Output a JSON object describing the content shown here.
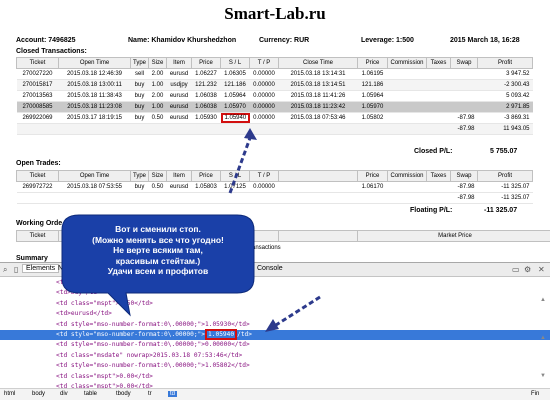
{
  "site": {
    "title": "Smart-Lab.ru"
  },
  "account": {
    "number": "Account: 7496825",
    "name": "Name: Khamidov Khurshedzhon",
    "currency": "Currency: RUR",
    "leverage": "Leverage: 1:500",
    "datetime": "2015 March 18, 16:28"
  },
  "closed": {
    "heading": "Closed Transactions:",
    "headers": [
      "Ticket",
      "Open Time",
      "Type",
      "Size",
      "Item",
      "Price",
      "S / L",
      "T / P",
      "Close Time",
      "Price",
      "Commission",
      "Taxes",
      "Swap",
      "Profit"
    ],
    "rows": [
      [
        "270027220",
        "2015.03.18 12:46:39",
        "sell",
        "2.00",
        "eurusd",
        "1.06227",
        "1.06305",
        "0.00000",
        "2015.03.18 13:14:31",
        "1.06195",
        "",
        "",
        "",
        "3 947.52"
      ],
      [
        "270015817",
        "2015.03.18 13:00:11",
        "buy",
        "1.00",
        "usdjpy",
        "121.232",
        "121.186",
        "0.00000",
        "2015.03.18 13:14:51",
        "121.186",
        "",
        "",
        "",
        "-2 300.43"
      ],
      [
        "270013563",
        "2015.03.18 11:38:43",
        "buy",
        "2.00",
        "eurusd",
        "1.06038",
        "1.05964",
        "0.00000",
        "2015.03.18 11:41:26",
        "1.05964",
        "",
        "",
        "",
        "5 093.42"
      ],
      [
        "270008585",
        "2015.03.18 11:23:08",
        "buy",
        "1.00",
        "eurusd",
        "1.06038",
        "1.05970",
        "0.00000",
        "2015.03.18 11:23:42",
        "1.05970",
        "",
        "",
        "",
        "2 971.85"
      ],
      [
        "269922069",
        "2015.03.17 18:19:15",
        "buy",
        "0.50",
        "eurusd",
        "1.05930",
        "1.05940",
        "0.00000",
        "2015.03.18 07:53:46",
        "1.05802",
        "",
        "",
        "-87.98",
        "-3 869.31"
      ],
      [
        "",
        "",
        "",
        "",
        "",
        "",
        "",
        "",
        "",
        "",
        "",
        "",
        "-87.98",
        "11 943.05"
      ]
    ],
    "total_label": "Closed P/L:",
    "total_value": "5 755.07"
  },
  "open": {
    "heading": "Open Trades:",
    "headers": [
      "Ticket",
      "Open Time",
      "Type",
      "Size",
      "Item",
      "Price",
      "S / L",
      "T / P",
      "",
      "Price",
      "Commission",
      "Taxes",
      "Swap",
      "Profit"
    ],
    "rows": [
      [
        "269972722",
        "2015.03.18 07:53:55",
        "buy",
        "0.50",
        "eurusd",
        "1.05803",
        "1.07125",
        "0.00000",
        "",
        "1.06170",
        "",
        "",
        "-87.98",
        "-11 325.07"
      ],
      [
        "",
        "",
        "",
        "",
        "",
        "",
        "",
        "",
        "",
        "",
        "",
        "",
        "-87.98",
        "-11 325.07"
      ]
    ],
    "total_label": "Floating P/L:",
    "total_value": "-11 325.07"
  },
  "working": {
    "heading": "Working Orde",
    "headers": [
      "Ticket",
      "Open Time",
      "",
      "",
      "",
      "",
      "",
      "",
      "",
      "Market Price"
    ],
    "partial_text": "ansactions"
  },
  "summary": {
    "heading": "Summary"
  },
  "callout": {
    "lines": [
      "Вот и сменили стоп.",
      "(Можно менять все что угодно!",
      "Не верте всяким там,",
      "красивым стейтам.)",
      "Удачи всем и профитов"
    ],
    "fill": "#1a40a8"
  },
  "devtools": {
    "tabs": [
      "Elements",
      "N",
      "Console"
    ],
    "code_lines": [
      "<td>269922069</td>",
      "<td>buy</td>",
      "<td class=\"mspt\">0.50</td>",
      "<td>eurusd</td>",
      "<td style=\"mso-number-format:0\\.00000;\">1.05930</td>",
      "<td style=\"mso-number-format:0\\.00000;\">",
      "<td style=\"mso-number-format:0\\.00000;\">0.00000</td>",
      "<td class=\"msdate\" nowrap>2015.03.18 07:53:46</td>",
      "<td style=\"mso-number-format:0\\.00000;\">1.05802</td>",
      "<td class=\"mspt\">0.00</td>",
      "<td class=\"mspt\">0.00</td>"
    ],
    "selected_value": "1.05940",
    "selected_tail": "</td>",
    "selected_visible_tail": "/td>",
    "crumbs": [
      "html",
      "body",
      "div",
      "table",
      "tbody",
      "tr",
      "td"
    ],
    "fin_label": "Fin"
  },
  "colors": {
    "highlight_box": "#d20f0f",
    "arrow": "#2d3a8c",
    "selection": "#3879d9"
  }
}
